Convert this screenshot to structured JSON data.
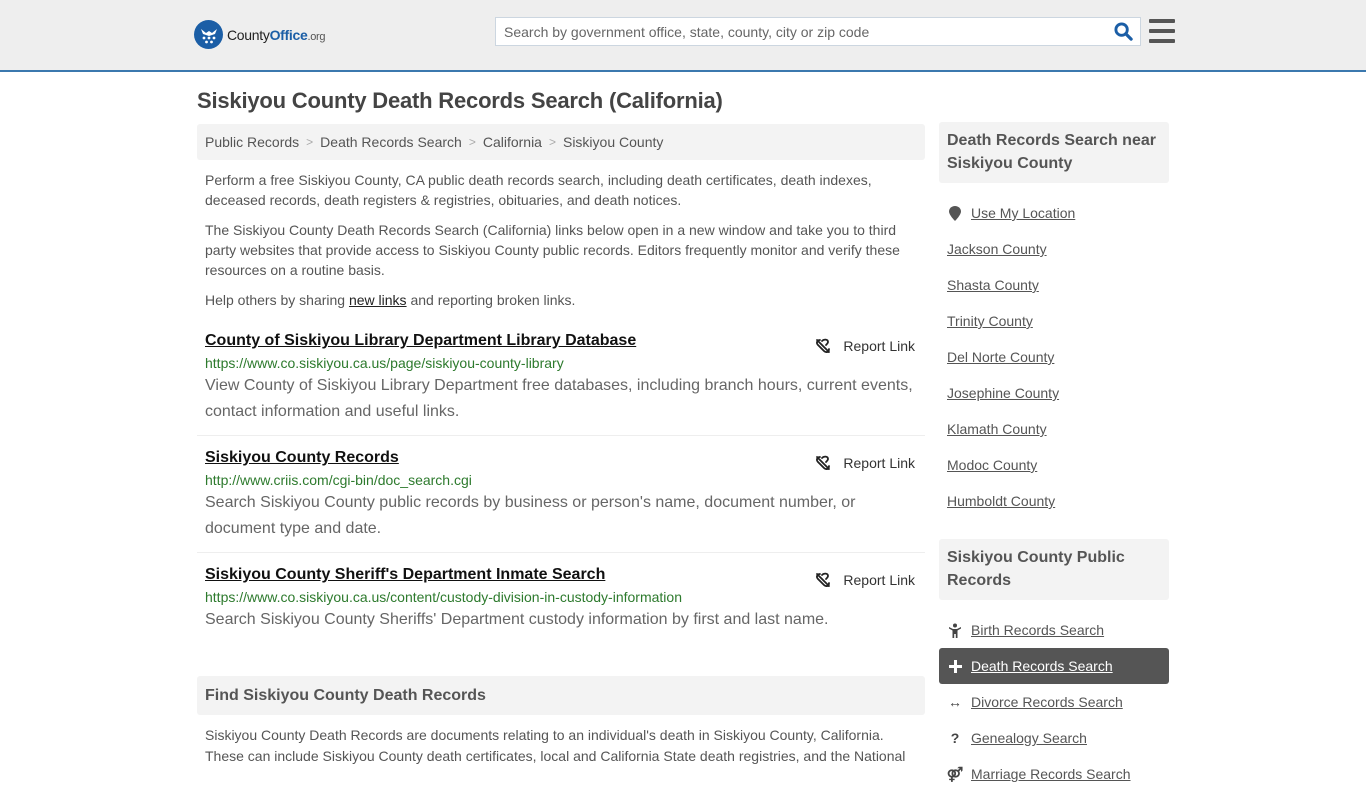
{
  "header": {
    "logo_text_a": "County",
    "logo_text_b": "Office",
    "logo_text_c": ".org",
    "search_placeholder": "Search by government office, state, county, city or zip code"
  },
  "page_title": "Siskiyou County Death Records Search (California)",
  "breadcrumb": [
    "Public Records",
    "Death Records Search",
    "California",
    "Siskiyou County"
  ],
  "intro": {
    "p1": "Perform a free Siskiyou County, CA public death records search, including death certificates, death indexes, deceased records, death registers & registries, obituaries, and death notices.",
    "p2": "The Siskiyou County Death Records Search (California) links below open in a new window and take you to third party websites that provide access to Siskiyou County public records. Editors frequently monitor and verify these resources on a routine basis.",
    "p3_before": "Help others by sharing ",
    "p3_link": "new links",
    "p3_after": " and reporting broken links."
  },
  "links": [
    {
      "title": "County of Siskiyou Library Department Library Database",
      "url": "https://www.co.siskiyou.ca.us/page/siskiyou-county-library",
      "description": "View County of Siskiyou Library Department free databases, including branch hours, current events, contact information and useful links.",
      "report_label": "Report Link"
    },
    {
      "title": "Siskiyou County Records",
      "url": "http://www.criis.com/cgi-bin/doc_search.cgi",
      "description": "Search Siskiyou County public records by business or person's name, document number, or document type and date.",
      "report_label": "Report Link"
    },
    {
      "title": "Siskiyou County Sheriff's Department Inmate Search",
      "url": "https://www.co.siskiyou.ca.us/content/custody-division-in-custody-information",
      "description": "Search Siskiyou County Sheriffs' Department custody information by first and last name.",
      "report_label": "Report Link"
    }
  ],
  "find": {
    "heading": "Find Siskiyou County Death Records",
    "text": "Siskiyou County Death Records are documents relating to an individual's death in Siskiyou County, California. These can include Siskiyou County death certificates, local and California State death registries, and the National"
  },
  "sidebar": {
    "nearby_heading": "Death Records Search near Siskiyou County",
    "use_location": "Use My Location",
    "nearby": [
      "Jackson County",
      "Shasta County",
      "Trinity County",
      "Del Norte County",
      "Josephine County",
      "Klamath County",
      "Modoc County",
      "Humboldt County"
    ],
    "records_heading": "Siskiyou County Public Records",
    "records": [
      {
        "label": "Birth Records Search",
        "icon": "child-icon",
        "glyph": "🯅"
      },
      {
        "label": "Death Records Search",
        "icon": "plus-icon",
        "glyph": "+",
        "active": true
      },
      {
        "label": "Divorce Records Search",
        "icon": "arrows-horizontal-icon",
        "glyph": "↔"
      },
      {
        "label": "Genealogy Search",
        "icon": "question-icon",
        "glyph": "?"
      },
      {
        "label": "Marriage Records Search",
        "icon": "marriage-icon",
        "glyph": "⚤"
      }
    ]
  },
  "colors": {
    "brand": "#1b5ea6",
    "header_border": "#3b78ae",
    "url_green": "#2d7a2d",
    "active_bg": "#555555"
  }
}
